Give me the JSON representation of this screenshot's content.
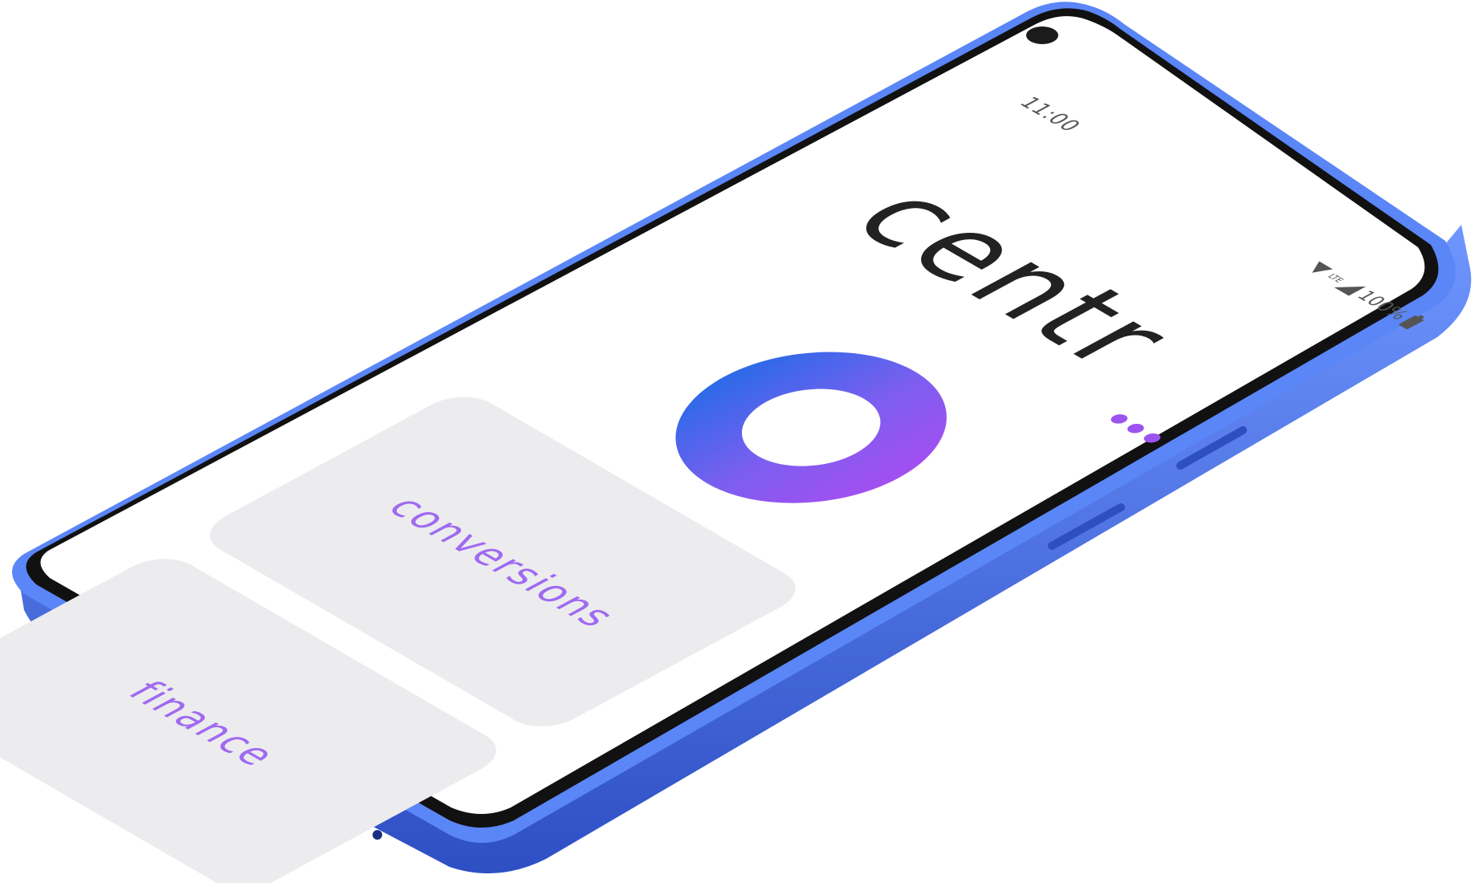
{
  "status_bar": {
    "time": "11:00",
    "network": "LTE",
    "battery": "100%"
  },
  "app": {
    "title": "centr"
  },
  "menu": {
    "icon": "more-dots-icon"
  },
  "tiles": [
    {
      "label": "conversions"
    },
    {
      "label": "finance"
    }
  ],
  "colors": {
    "accent_purple": "#9b54ee",
    "accent_blue": "#2c6ae8",
    "tile_background": "#ececef",
    "tile_text": "#a06af0",
    "phone_frame": "#5b86f5",
    "title_text": "#222222"
  }
}
